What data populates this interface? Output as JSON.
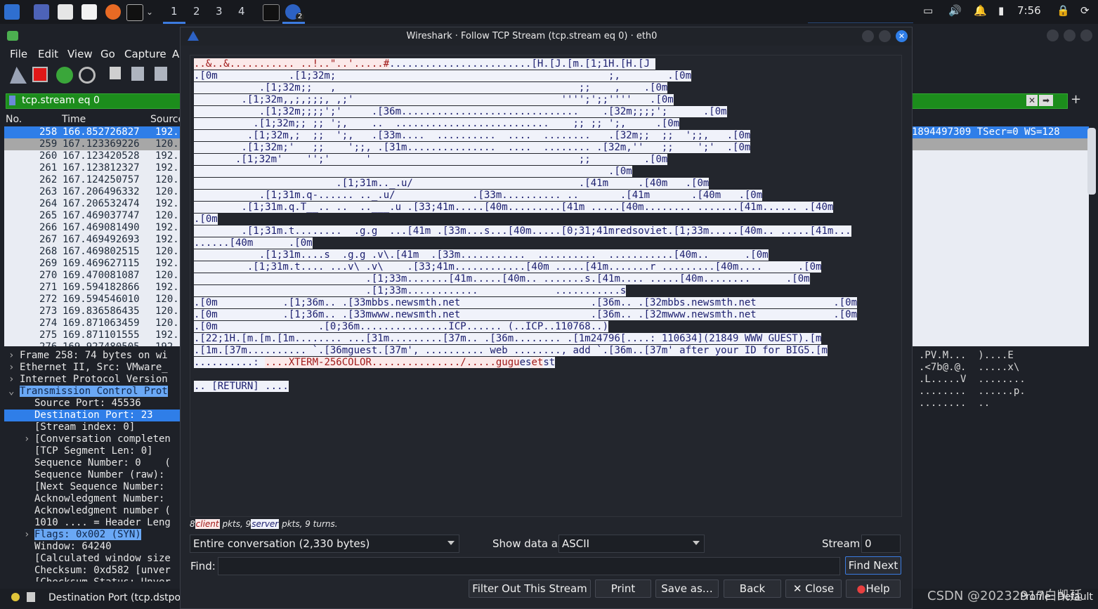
{
  "taskbar": {
    "workspaces": [
      "1",
      "2",
      "3",
      "4"
    ],
    "clock": "7:56",
    "badge": "2"
  },
  "main": {
    "menu": [
      "File",
      "Edit",
      "View",
      "Go",
      "Capture",
      "A"
    ],
    "filter": "tcp.stream eq 0",
    "columns": [
      "No.",
      "Time",
      "Source"
    ],
    "rows": [
      {
        "no": "258",
        "time": "166.852726827",
        "src": "192.",
        "selected": true
      },
      {
        "no": "259",
        "time": "167.123369226",
        "src": "120.",
        "marked": true
      },
      {
        "no": "260",
        "time": "167.123420528",
        "src": "192."
      },
      {
        "no": "261",
        "time": "167.123812327",
        "src": "192."
      },
      {
        "no": "262",
        "time": "167.124250757",
        "src": "120."
      },
      {
        "no": "263",
        "time": "167.206496332",
        "src": "120."
      },
      {
        "no": "264",
        "time": "167.206532474",
        "src": "192."
      },
      {
        "no": "265",
        "time": "167.469037747",
        "src": "120."
      },
      {
        "no": "266",
        "time": "167.469081490",
        "src": "192."
      },
      {
        "no": "267",
        "time": "167.469492693",
        "src": "192."
      },
      {
        "no": "268",
        "time": "167.469802515",
        "src": "120."
      },
      {
        "no": "269",
        "time": "169.469627115",
        "src": "192."
      },
      {
        "no": "270",
        "time": "169.470081087",
        "src": "120."
      },
      {
        "no": "271",
        "time": "169.594182866",
        "src": "192."
      },
      {
        "no": "272",
        "time": "169.594546010",
        "src": "120."
      },
      {
        "no": "273",
        "time": "169.836586435",
        "src": "120."
      },
      {
        "no": "274",
        "time": "169.871063459",
        "src": "120."
      },
      {
        "no": "275",
        "time": "169.871101555",
        "src": "192."
      },
      {
        "no": "276",
        "time": "169.927480505",
        "src": "192."
      }
    ],
    "row_info_right": "1894497309 TSecr=0 WS=128",
    "details": [
      {
        "indent": 0,
        "arrow": "›",
        "text": "Frame 258: 74 bytes on wi"
      },
      {
        "indent": 0,
        "arrow": "›",
        "text": "Ethernet II, Src: VMware_"
      },
      {
        "indent": 0,
        "arrow": "›",
        "text": "Internet Protocol Version"
      },
      {
        "indent": 0,
        "arrow": "⌄",
        "text": "Transmission Control Prot",
        "hl": true
      },
      {
        "indent": 1,
        "arrow": "",
        "text": "Source Port: 45536"
      },
      {
        "indent": 1,
        "arrow": "",
        "text": "Destination Port: 23",
        "sel": true
      },
      {
        "indent": 1,
        "arrow": "",
        "text": "[Stream index: 0]"
      },
      {
        "indent": 1,
        "arrow": "›",
        "text": "[Conversation completen"
      },
      {
        "indent": 1,
        "arrow": "",
        "text": "[TCP Segment Len: 0]"
      },
      {
        "indent": 1,
        "arrow": "",
        "text": "Sequence Number: 0    ("
      },
      {
        "indent": 1,
        "arrow": "",
        "text": "Sequence Number (raw):"
      },
      {
        "indent": 1,
        "arrow": "",
        "text": "[Next Sequence Number:"
      },
      {
        "indent": 1,
        "arrow": "",
        "text": "Acknowledgment Number:"
      },
      {
        "indent": 1,
        "arrow": "",
        "text": "Acknowledgment number ("
      },
      {
        "indent": 1,
        "arrow": "",
        "text": "1010 .... = Header Leng"
      },
      {
        "indent": 1,
        "arrow": "›",
        "text": "Flags: 0x002 (SYN)",
        "hl": true
      },
      {
        "indent": 1,
        "arrow": "",
        "text": "Window: 64240"
      },
      {
        "indent": 1,
        "arrow": "",
        "text": "[Calculated window size"
      },
      {
        "indent": 1,
        "arrow": "",
        "text": "Checksum: 0xd582 [unver"
      },
      {
        "indent": 1,
        "arrow": "",
        "text": "[Checksum Status: Unver"
      }
    ],
    "hex": [
      ".PV.M...  )....E",
      ".<7b@.@.  .....x\\",
      ".L.....V  ........",
      "........  ......p.",
      "........  .."
    ],
    "status": "Destination Port (tcp.dstpor",
    "profile": "Profile: Default"
  },
  "dialog": {
    "title": "Wireshark · Follow TCP Stream (tcp.stream eq 0) · eth0",
    "lines": [
      [
        {
          "k": "cli",
          "t": "..&..&........... ..!..\"..'.....#"
        },
        {
          "k": "srv",
          "t": "........................[H.[J.[m.[1;1H.[H.[J "
        }
      ],
      [
        {
          "k": "srv",
          "t": ".[0m            .[1;32m;                                              ;,        .[0m"
        }
      ],
      [
        {
          "k": "srv",
          "t": "           .[1;32m;;   ,                                         ;;    ,    .[0m"
        }
      ],
      [
        {
          "k": "srv",
          "t": "        .[1;32m,,;,;;;, ,;'                                   '''';';;''''   .[0m"
        }
      ],
      [
        {
          "k": "srv",
          "t": "           .[1;32m;;;;';'     .[36m..............................    .[32m;;;;';      .[0m"
        }
      ],
      [
        {
          "k": "srv",
          "t": "          .[1;32m;; ;; ';,    ..  ..........................    ;; ;; ';,     .[0m"
        }
      ],
      [
        {
          "k": "srv",
          "t": "         .[1;32m,;  ;;  ';,   .[33m....  ..........  ....  ........   .[32m;;  ;;  ';;,   .[0m"
        }
      ],
      [
        {
          "k": "srv",
          "t": "        .[1;32m;'   ;;    ';;, .[31m...............  ....  ........ .[32m,''   ;;    ';'  .[0m"
        }
      ],
      [
        {
          "k": "srv",
          "t": "       .[1;32m'    '';'      '                                   ;;         .[0m"
        }
      ],
      [
        {
          "k": "srv",
          "t": "                                                                      .[0m"
        }
      ],
      [
        {
          "k": "srv",
          "t": "                        .[1;31m.._.u/                            .[41m     .[40m   .[0m"
        }
      ],
      [
        {
          "k": "srv",
          "t": "           .[1;31m.q-...... .._.u/             .[33m.......... ..       .[41m       .[40m   .[0m"
        }
      ],
      [
        {
          "k": "srv",
          "t": "        .[1;31m.q.T__.. ..  ..___.u .[33;41m.....[40m.........[41m .....[40m........ .......[41m...... .[40m"
        }
      ],
      [
        {
          "k": "srv",
          "t": ".[0m"
        }
      ],
      [
        {
          "k": "srv",
          "t": "        .[1;31m.t........  .g.g  ...[41m .[33m...s...[40m.....[0;31;41mredsoviet.[1;33m.....[40m.. .....[41m..."
        }
      ],
      [
        {
          "k": "srv",
          "t": "......[40m      .[0m"
        }
      ],
      [
        {
          "k": "srv",
          "t": "           .[1;31m....s  .g.g .v\\.[41m  .[33m...........  ..........  ...........[40m..      .[0m"
        }
      ],
      [
        {
          "k": "srv",
          "t": "         .[1;31m.t.... ...v\\ .v\\    .[33;41m............[40m .....[41m.......r .........[40m....      .[0m"
        }
      ],
      [
        {
          "k": "srv",
          "t": "                             .[1;33m.......[41m.....[40m.. .......s.[41m.... .....[40m........      .[0m"
        }
      ],
      [
        {
          "k": "srv",
          "t": "                             .[1;33m............             ...........s"
        }
      ],
      [
        {
          "k": "srv",
          "t": ".[0m           .[1;36m.. .[33mbbs.newsmth.net                      .[36m.. .[32mbbs.newsmth.net             .[0m"
        }
      ],
      [
        {
          "k": "srv",
          "t": ".[0m           .[1;36m.. .[33mwww.newsmth.net                      .[36m.. .[32mwww.newsmth.net             .[0m"
        }
      ],
      [
        {
          "k": "srv",
          "t": ".[0m                 .[0;36m...............ICP...... (..ICP..110768..)"
        }
      ],
      [
        {
          "k": "srv",
          "t": ".[22;1H.[m.[m.[1m........ ...[31m.........[37m.. .[36m........ .[1m24796[....: 110634](21849 WWW GUEST).[m"
        }
      ],
      [
        {
          "k": "srv",
          "t": ".[1m.[37m.......... `.[36mguest.[37m', .......... web ........, add `.[36m..[37m' after your ID for BIG5.[m"
        }
      ],
      [
        {
          "k": "srv",
          "t": "..........: "
        },
        {
          "k": "cli",
          "t": "....XTERM-256COLOR.............../.....gugu"
        },
        {
          "k": "srv",
          "t": "es"
        },
        {
          "k": "cli",
          "t": "et"
        },
        {
          "k": "srv",
          "t": "st"
        }
      ],
      [],
      [
        {
          "k": "srv",
          "t": ".. [RETURN] ...."
        }
      ]
    ],
    "summary": {
      "client_count": "8",
      "client": "client",
      "client_suffix": "pkts,",
      "server_count": "9",
      "server": "server",
      "server_suffix": "pkts, 9 turns."
    },
    "conversation": "Entire conversation (2,330 bytes)",
    "show_label": "Show data as",
    "show_value": "ASCII",
    "stream_label": "Stream",
    "stream_value": "0",
    "find_label": "Find:",
    "find_next": "Find Next",
    "buttons": {
      "filter": "Filter Out This Stream",
      "print": "Print",
      "save": "Save as…",
      "back": "Back",
      "close": "Close",
      "help": "Help"
    }
  },
  "watermark": "CSDN @20232917白凯廷"
}
